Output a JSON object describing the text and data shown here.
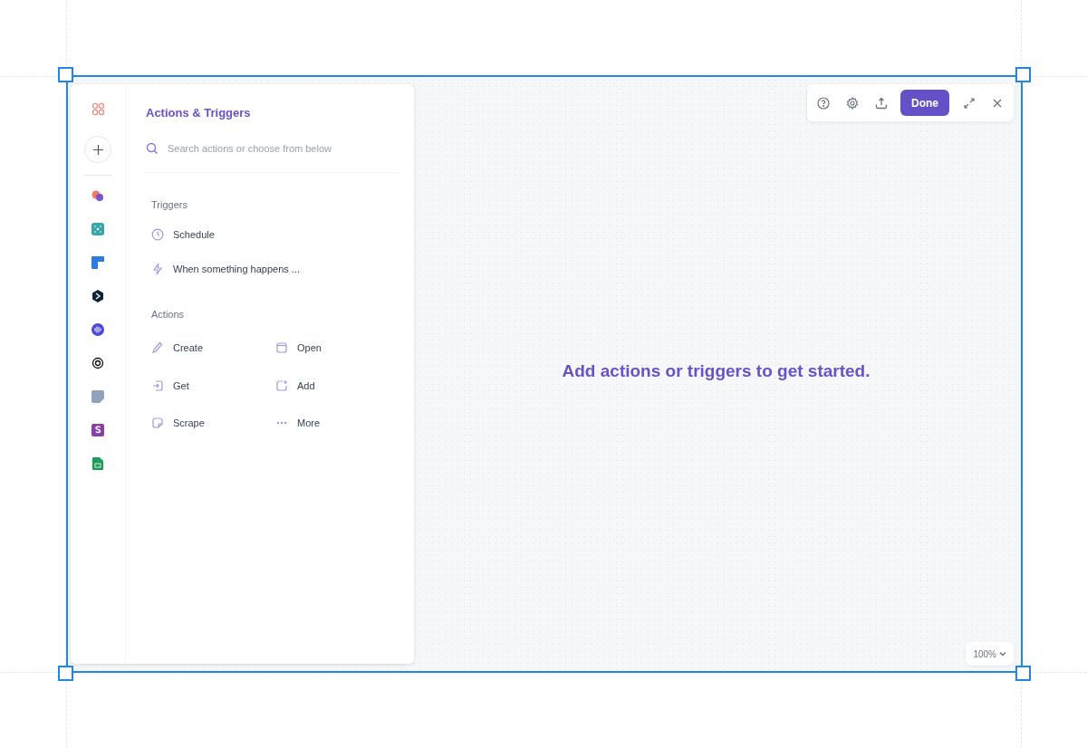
{
  "panel": {
    "title": "Actions & Triggers",
    "search": {
      "placeholder": "Search actions or choose from below"
    },
    "triggers": {
      "heading": "Triggers",
      "items": [
        {
          "label": "Schedule"
        },
        {
          "label": "When something happens ..."
        }
      ]
    },
    "actions": {
      "heading": "Actions",
      "items": [
        {
          "label": "Create"
        },
        {
          "label": "Open"
        },
        {
          "label": "Get"
        },
        {
          "label": "Add"
        },
        {
          "label": "Scrape"
        },
        {
          "label": "More"
        }
      ]
    }
  },
  "toolbar": {
    "done_button": "Done"
  },
  "canvas": {
    "message": "Add actions or triggers to get started.",
    "zoom": "100%"
  }
}
